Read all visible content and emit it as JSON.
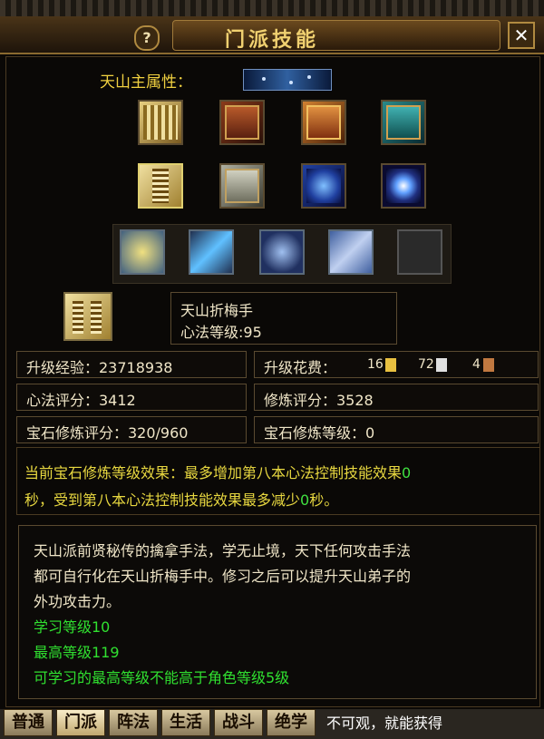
{
  "window": {
    "title": "门派技能",
    "help_label": "?",
    "close_label": "✕"
  },
  "attribute": {
    "label": "天山主属性："
  },
  "books_row1": [
    {
      "icon": "scroll-book-icon"
    },
    {
      "icon": "red-book-icon"
    },
    {
      "icon": "orange-book-icon"
    },
    {
      "icon": "teal-book-icon"
    }
  ],
  "books_row2": [
    {
      "icon": "yellow-book-icon",
      "selected": true
    },
    {
      "icon": "gray-book-icon"
    },
    {
      "icon": "blue-scroll-icon"
    },
    {
      "icon": "galaxy-icon"
    }
  ],
  "skills": [
    {
      "icon": "fan-skill-icon"
    },
    {
      "icon": "beam-skill-icon"
    },
    {
      "icon": "tornado-skill-icon"
    },
    {
      "icon": "paper-skill-icon"
    },
    {
      "icon": "empty-slot-icon"
    }
  ],
  "current_skill": {
    "name": "天山折梅手",
    "level": "心法等级:95"
  },
  "stats": {
    "upgrade_exp": "升级经验：23718938",
    "upgrade_cost_label": "升级花费：",
    "cost_gold": "16",
    "cost_silver": "72",
    "cost_copper": "4",
    "heart_score": "心法评分：3412",
    "cultivate_score": "修炼评分：3528",
    "gem_score": "宝石修炼评分：320/960",
    "gem_level": "宝石修炼等级：0"
  },
  "effect": {
    "line1": "当前宝石修炼等级效果：最多增加第八本心法控制技能效果",
    "line1_value": "0",
    "line2_a": "秒，受到第八本心法控制技能效果最多减少",
    "line2_value": "0",
    "line2_b": "秒。"
  },
  "description": {
    "line1": "天山派前贤秘传的擒拿手法，学无止境，天下任何攻击手法",
    "line2": "都可自行化在天山折梅手中。修习之后可以提升天山弟子的",
    "line3": "外功攻击力。",
    "learn_level": "学习等级10",
    "max_level": "最高等级119",
    "note": "可学习的最高等级不能高于角色等级5级"
  },
  "tabs": [
    "普通",
    "门派",
    "阵法",
    "生活",
    "战斗",
    "绝学"
  ],
  "background_text": "不可观，就能获得",
  "colors": {
    "gold": "#f0d040",
    "green": "#30e030",
    "frame": "#5a4a30"
  }
}
